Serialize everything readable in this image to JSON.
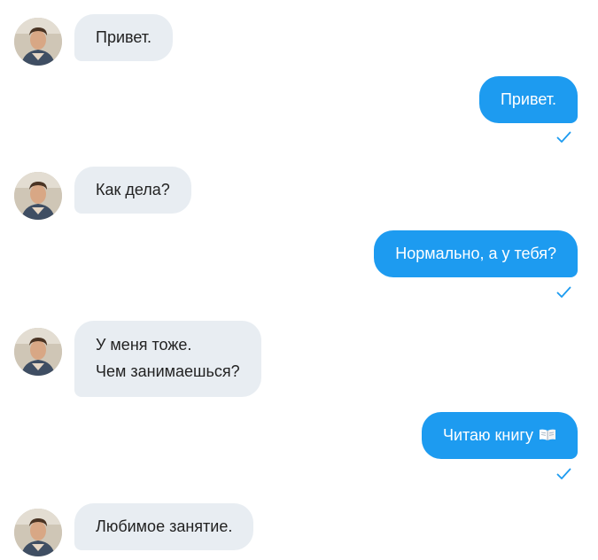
{
  "messages": [
    {
      "direction": "incoming",
      "text": "Привет."
    },
    {
      "direction": "outgoing",
      "text": "Привет.",
      "status": "check-icon"
    },
    {
      "direction": "incoming",
      "text": "Как дела?"
    },
    {
      "direction": "outgoing",
      "text": "Нормально, а у тебя?",
      "status": "check-icon"
    },
    {
      "direction": "incoming",
      "lines": [
        "У меня тоже.",
        "Чем занимаешься?"
      ]
    },
    {
      "direction": "outgoing",
      "text": "Читаю книгу",
      "emoji": "open-book-icon",
      "status": "check-icon"
    },
    {
      "direction": "incoming",
      "text": "Любимое занятие."
    }
  ],
  "colors": {
    "incoming_bubble": "#e8edf2",
    "outgoing_bubble": "#1d9bf0",
    "check": "#1d9bf0"
  }
}
